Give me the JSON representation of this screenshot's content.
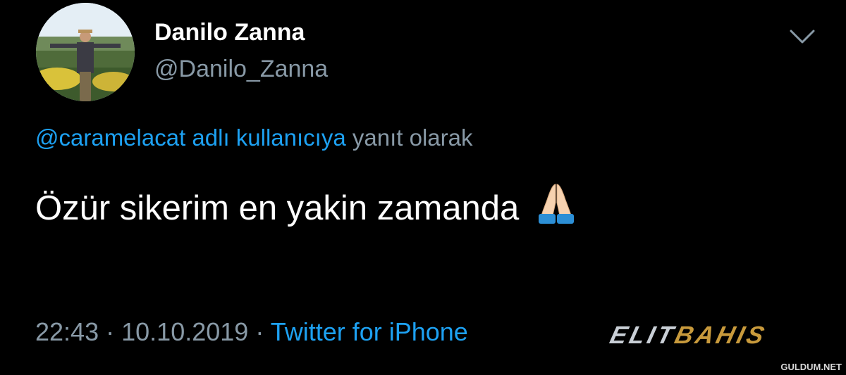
{
  "tweet": {
    "author": {
      "display_name": "Danilo Zanna",
      "handle": "@Danilo_Zanna"
    },
    "reply_to": {
      "user": "@caramelacat adlı kullanıcıya",
      "suffix": "yanıt olarak"
    },
    "text": "Özür sikerim en yakin zamanda",
    "emoji": "folded-hands-emoji",
    "meta": {
      "time": "22:43",
      "separator": "·",
      "date": "10.10.2019",
      "source": "Twitter for iPhone"
    },
    "menu_icon": "chevron-down-icon"
  },
  "watermarks": {
    "logo_part1": "ELIT",
    "logo_part2": "BAHIS",
    "site": "GULDUM.NET"
  },
  "colors": {
    "background": "#000000",
    "primary_text": "#ffffff",
    "secondary_text": "#8899a6",
    "link": "#1da1f2",
    "logo_gold": "#c89a3c"
  }
}
